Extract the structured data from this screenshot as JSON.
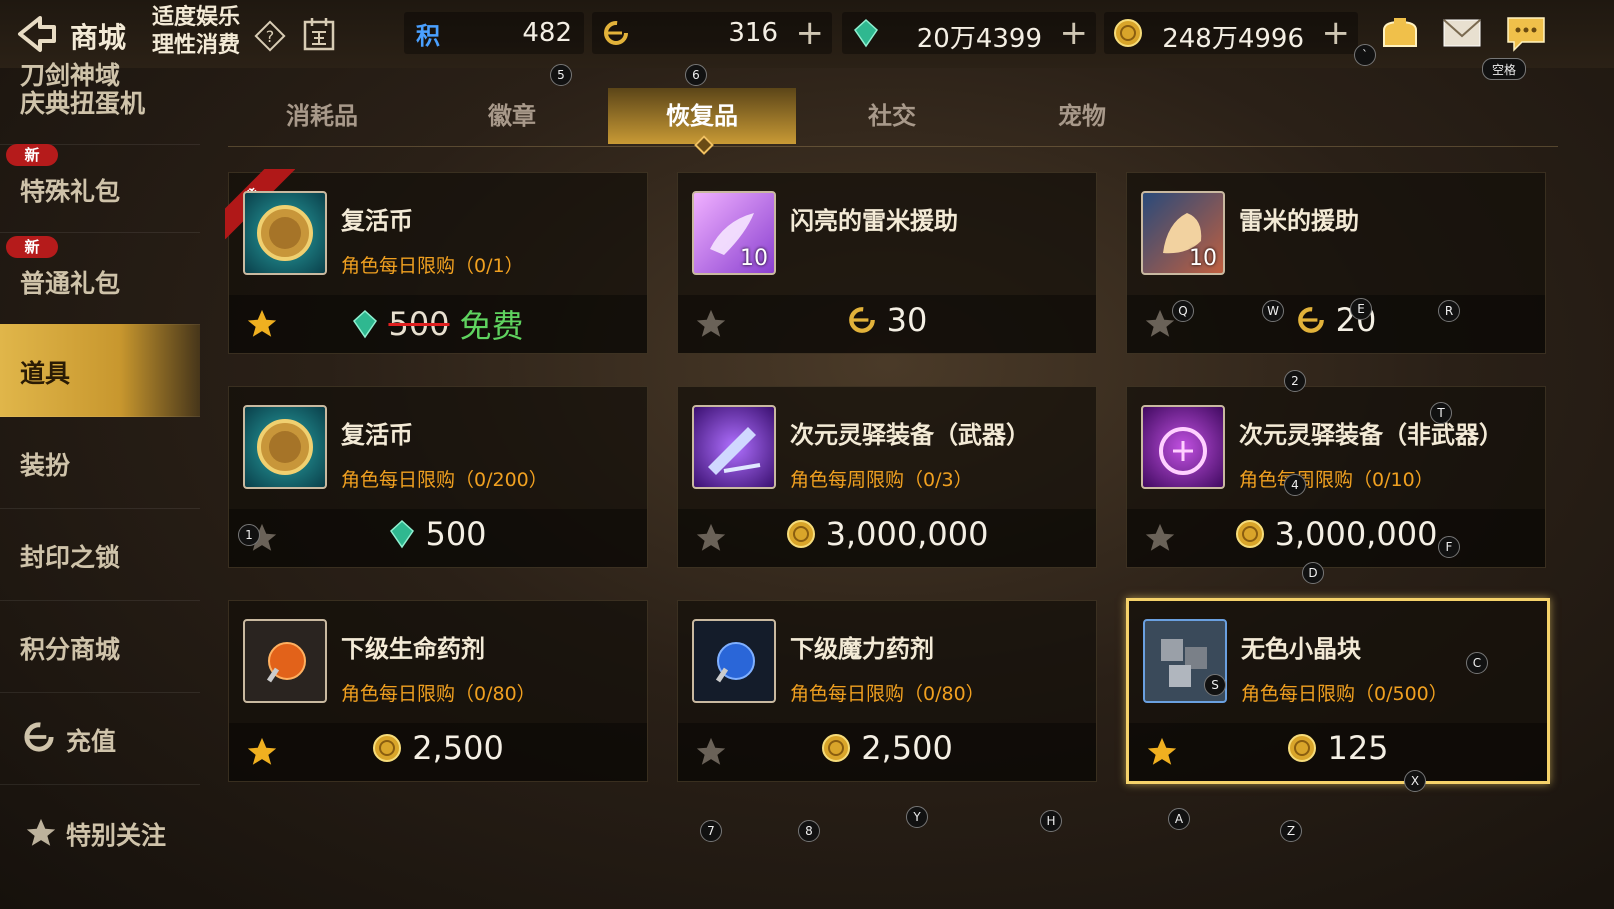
{
  "topbar": {
    "title": "商城",
    "slogan": "适度娱乐 理性消费",
    "currencies": [
      {
        "icon": "points-icon",
        "icon_text": "积",
        "value": "482",
        "plus": ""
      },
      {
        "icon": "c-coin-icon",
        "value": "316",
        "plus": "+"
      },
      {
        "icon": "crystal-icon",
        "value": "20万4399",
        "plus": "+"
      },
      {
        "icon": "gold-icon",
        "value": "248万4996",
        "plus": "+"
      }
    ],
    "hint_space": "空格"
  },
  "sidebar": {
    "items": [
      {
        "label": "刀剑神域\n庆典扭蛋机",
        "badge": ""
      },
      {
        "label": "特殊礼包",
        "badge": "新"
      },
      {
        "label": "普通礼包",
        "badge": "新"
      },
      {
        "label": "道具",
        "badge": ""
      },
      {
        "label": "装扮",
        "badge": ""
      },
      {
        "label": "封印之锁",
        "badge": ""
      },
      {
        "label": "积分商城",
        "badge": ""
      },
      {
        "label": "充值",
        "badge": ""
      },
      {
        "label": "特别关注",
        "badge": ""
      }
    ]
  },
  "tabs": [
    "消耗品",
    "徽章",
    "恢复品",
    "社交",
    "宠物"
  ],
  "active_tab": "恢复品",
  "items": [
    {
      "name": "复活币",
      "limit": "角色每日限购（0/1）",
      "price_old": "500",
      "price_new": "免费",
      "currency": "crystal",
      "starred": true,
      "ribbon": "推",
      "qty": ""
    },
    {
      "name": "闪亮的雷米援助",
      "limit": "",
      "price": "30",
      "currency": "c-coin",
      "starred": false,
      "qty": "10"
    },
    {
      "name": "雷米的援助",
      "limit": "",
      "price": "20",
      "currency": "c-coin",
      "starred": false,
      "qty": "10"
    },
    {
      "name": "复活币",
      "limit": "角色每日限购（0/200）",
      "price": "500",
      "currency": "crystal",
      "starred": false,
      "qty": ""
    },
    {
      "name": "次元灵驿装备（武器）",
      "limit": "角色每周限购（0/3）",
      "price": "3,000,000",
      "currency": "gold",
      "starred": false,
      "qty": ""
    },
    {
      "name": "次元灵驿装备（非武器）",
      "limit": "角色每周限购（0/10）",
      "price": "3,000,000",
      "currency": "gold",
      "starred": false,
      "qty": ""
    },
    {
      "name": "下级生命药剂",
      "limit": "角色每日限购（0/80）",
      "price": "2,500",
      "currency": "gold",
      "starred": true,
      "qty": ""
    },
    {
      "name": "下级魔力药剂",
      "limit": "角色每日限购（0/80）",
      "price": "2,500",
      "currency": "gold",
      "starred": false,
      "qty": ""
    },
    {
      "name": "无色小晶块",
      "limit": "角色每日限购（0/500）",
      "price": "125",
      "currency": "gold",
      "starred": true,
      "qty": "",
      "selected": true
    }
  ],
  "hints": [
    "5",
    "6",
    "`",
    "Q",
    "W",
    "E",
    "R",
    "2",
    "T",
    "4",
    "1",
    "F",
    "D",
    "C",
    "S",
    "X",
    "7",
    "8",
    "Y",
    "H",
    "A",
    "Z"
  ]
}
